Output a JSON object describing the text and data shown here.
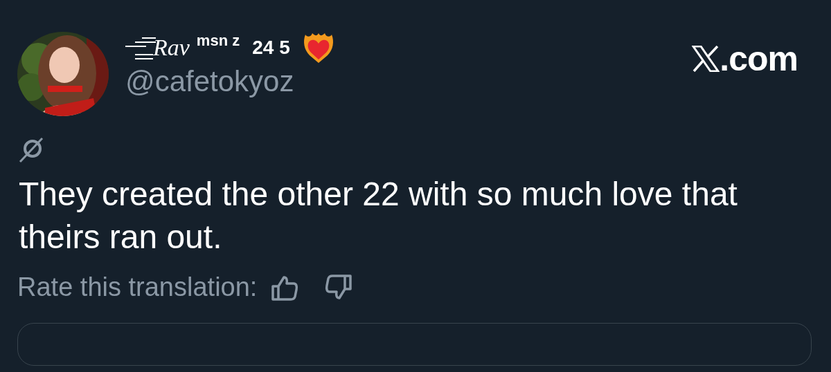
{
  "author": {
    "name": "Rav",
    "badge": "msn z",
    "number": "24 5",
    "handle": "@cafetokyoz"
  },
  "site": {
    "label": ".com"
  },
  "tweet": {
    "text": "They created the other 22 with so much love that theirs ran out."
  },
  "rating": {
    "label": "Rate this translation:"
  }
}
